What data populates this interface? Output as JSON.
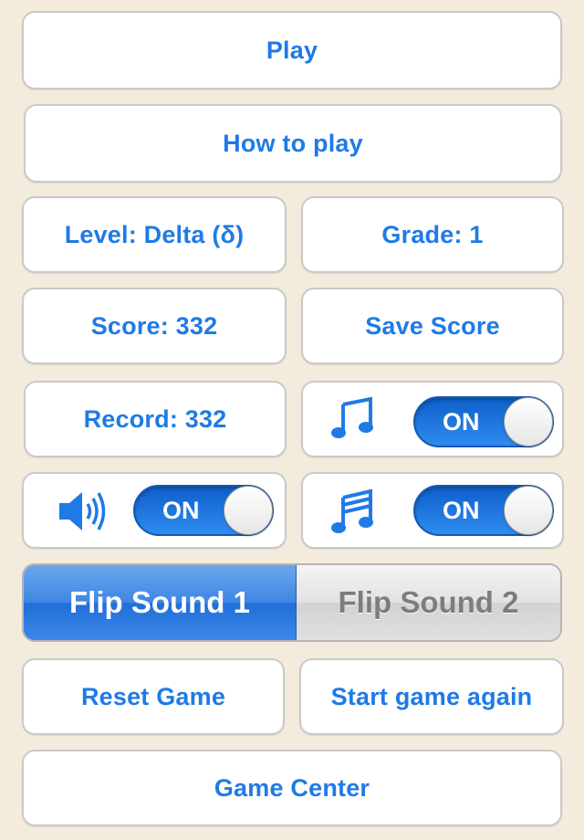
{
  "menu": {
    "play_label": "Play",
    "how_to_play_label": "How to play",
    "level_label": "Level: Delta (δ)",
    "grade_label": "Grade: 1",
    "score_label": "Score: 332",
    "save_score_label": "Save Score",
    "record_label": "Record: 332",
    "reset_game_label": "Reset Game",
    "start_again_label": "Start game again",
    "game_center_label": "Game Center"
  },
  "toggles": {
    "music_note_toggle": {
      "icon": "music-note-icon",
      "label": "ON"
    },
    "sound_effects_toggle": {
      "icon": "speaker-icon",
      "label": "ON"
    },
    "music_track_toggle": {
      "icon": "music-notes-icon",
      "label": "ON"
    }
  },
  "flip_sound": {
    "options": [
      "Flip Sound 1",
      "Flip Sound 2"
    ],
    "selected": "Flip Sound 1"
  },
  "colors": {
    "background": "#f3ecdc",
    "accent": "#1f7ae6",
    "toggle_on": "#1a73e0"
  }
}
